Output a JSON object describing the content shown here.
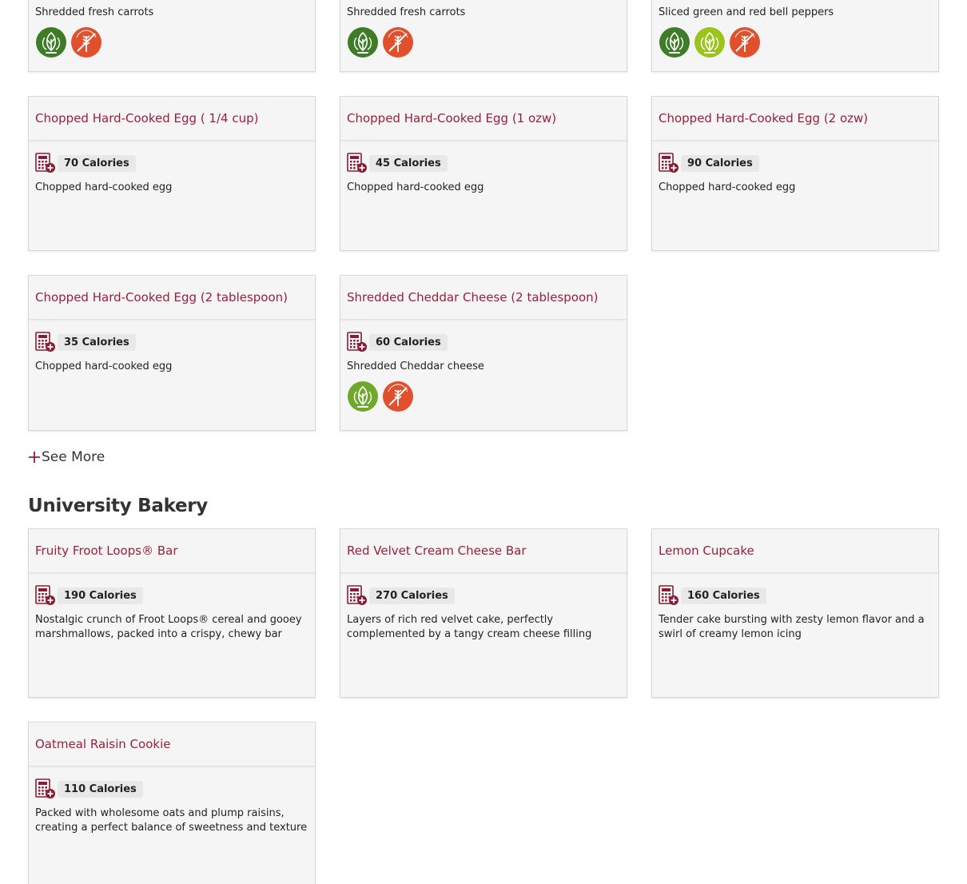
{
  "top_row": [
    {
      "description": "Shredded fresh carrots",
      "badges": [
        "vegan",
        "no-gluten"
      ]
    },
    {
      "description": "Shredded fresh carrots",
      "badges": [
        "vegan",
        "no-gluten"
      ]
    },
    {
      "description": "Sliced green and red bell peppers",
      "badges": [
        "vegan",
        "plant-forward",
        "no-gluten"
      ]
    }
  ],
  "toppings": [
    {
      "title": "Chopped Hard-Cooked Egg ( 1/4 cup)",
      "calories": "70 Calories",
      "description": "Chopped hard-cooked egg"
    },
    {
      "title": "Chopped Hard-Cooked Egg (1 ozw)",
      "calories": "45 Calories",
      "description": "Chopped hard-cooked egg"
    },
    {
      "title": "Chopped Hard-Cooked Egg (2 ozw)",
      "calories": "90 Calories",
      "description": "Chopped hard-cooked egg"
    },
    {
      "title": "Chopped Hard-Cooked Egg (2 tablespoon)",
      "calories": "35 Calories",
      "description": "Chopped hard-cooked egg"
    },
    {
      "title": "Shredded Cheddar Cheese (2 tablespoon)",
      "calories": "60 Calories",
      "description": "Shredded Cheddar cheese",
      "badges": [
        "vegetarian",
        "no-gluten"
      ]
    }
  ],
  "see_more": "See More",
  "bakery": {
    "title": "University Bakery",
    "items": [
      {
        "title": "Fruity Froot Loops® Bar",
        "calories": "190 Calories",
        "description": "Nostalgic crunch of Froot Loops® cereal and gooey marshmallows, packed into a crispy, chewy bar"
      },
      {
        "title": "Red Velvet Cream Cheese Bar",
        "calories": "270 Calories",
        "description": "Layers of rich red velvet cake, perfectly complemented by a tangy cream cheese filling"
      },
      {
        "title": "Lemon Cupcake",
        "calories": "160 Calories",
        "description": "Tender cake bursting with zesty lemon flavor and a swirl of creamy lemon icing"
      },
      {
        "title": "Oatmeal Raisin Cookie",
        "calories": "110 Calories",
        "description": "Packed with wholesome oats and plump raisins, creating a perfect balance of sweetness and texture"
      }
    ]
  },
  "colors": {
    "title_red": "#9a1f3a",
    "vegan_green": "#3f7c28",
    "vegetarian_green": "#6fa82c",
    "plant_forward_green": "#9cc41c",
    "no_gluten_orange": "#e0502c",
    "calc_icon_red": "#8b1a33"
  }
}
